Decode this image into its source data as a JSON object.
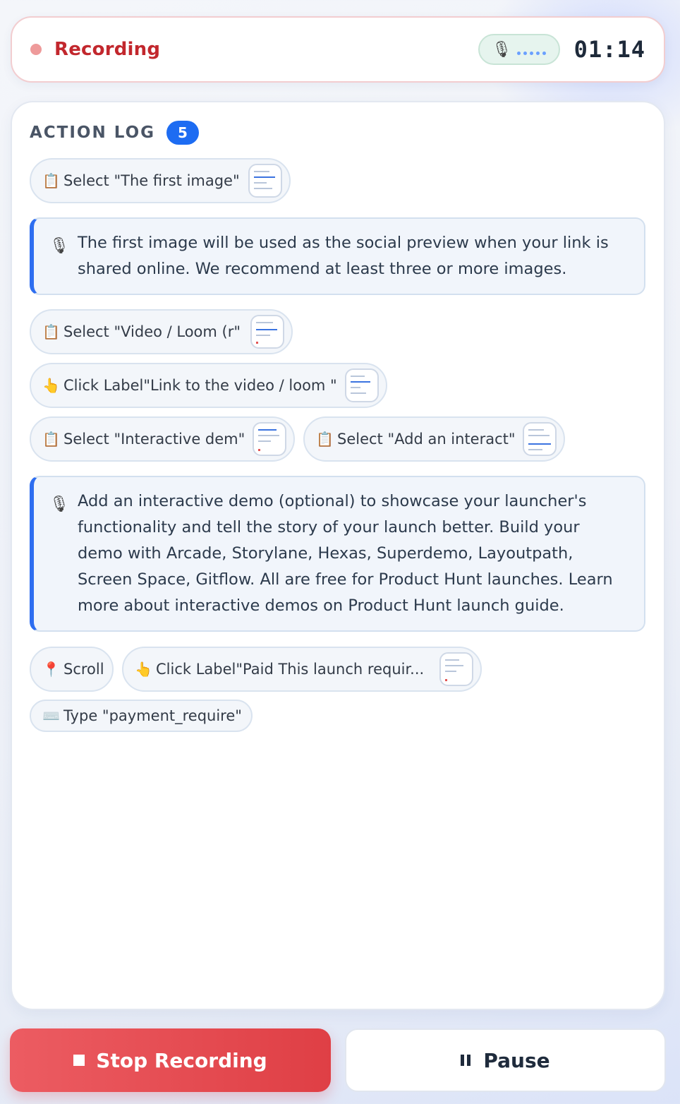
{
  "status": {
    "label": "Recording",
    "mic_icon": "microphone-icon",
    "timer": "01:14"
  },
  "log": {
    "title": "ACTION LOG",
    "count": "5",
    "entries": [
      {
        "icon": "📋",
        "icon_name": "clipboard-icon",
        "label": "Select \"The first image\""
      },
      {
        "text": "The first image will be used as the social preview when your link is shared online. We recommend at least three or more images."
      },
      {
        "icon": "📋",
        "icon_name": "clipboard-icon",
        "label": "Select \"Video / Loom (r\""
      },
      {
        "icon": "👆",
        "icon_name": "pointing-hand-icon",
        "label": "Click Label\"Link to the video / loom \""
      },
      {
        "icon": "📋",
        "icon_name": "clipboard-icon",
        "label": "Select \"Interactive dem\""
      },
      {
        "icon": "📋",
        "icon_name": "clipboard-icon",
        "label": "Select \"Add an interact\""
      },
      {
        "text": "Add an interactive demo (optional) to showcase your launcher's functionality and tell the story of your launch better. Build your demo with Arcade, Storylane, Hexas, Superdemo, Layoutpath, Screen Space, Gitflow. All are free for Product Hunt launches. Learn more about interactive demos on Product Hunt launch guide."
      },
      {
        "icon": "📍",
        "icon_name": "pin-icon",
        "label": "Scroll"
      },
      {
        "icon": "👆",
        "icon_name": "pointing-hand-icon",
        "label": "Click Label\"Paid This launch requir..."
      },
      {
        "icon": "⌨️",
        "icon_name": "keyboard-icon",
        "label": "Type \"payment_require\""
      }
    ]
  },
  "buttons": {
    "stop": "Stop Recording",
    "pause": "Pause"
  },
  "colors": {
    "recording_red": "#c2272d",
    "accent_blue": "#1d6cf2",
    "stop_button": "#e4474d"
  }
}
